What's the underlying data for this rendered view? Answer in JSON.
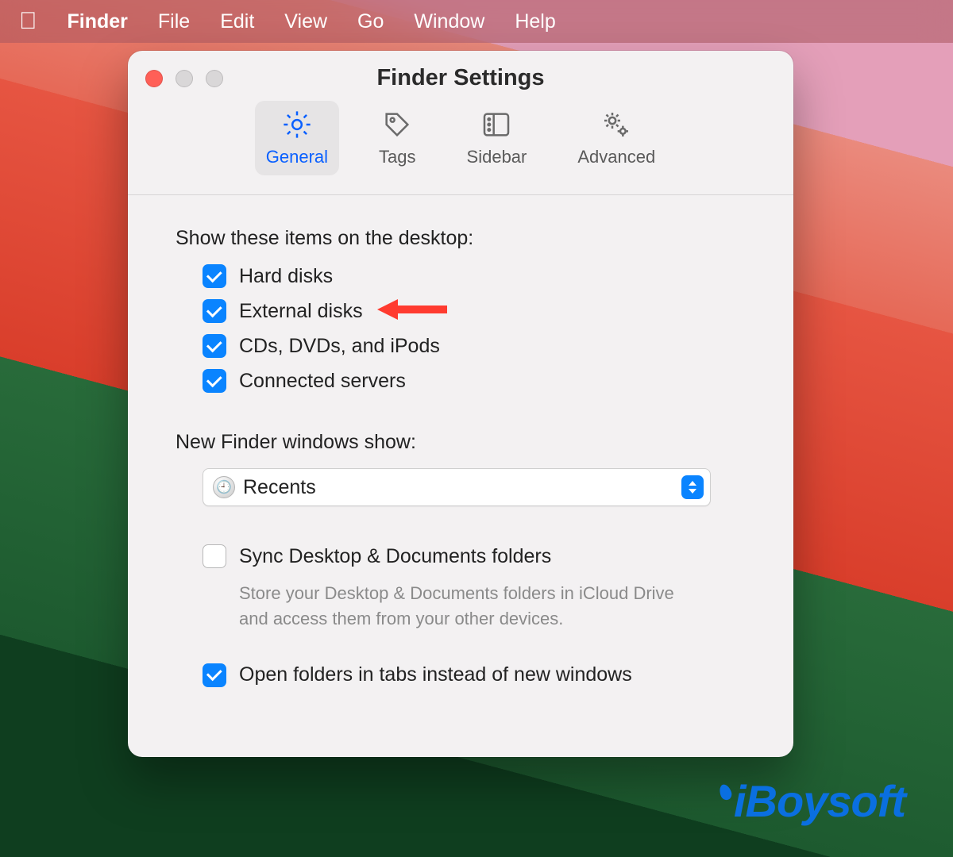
{
  "menubar": {
    "app": "Finder",
    "items": [
      "File",
      "Edit",
      "View",
      "Go",
      "Window",
      "Help"
    ]
  },
  "window": {
    "title": "Finder Settings",
    "tabs": [
      {
        "label": "General",
        "active": true
      },
      {
        "label": "Tags",
        "active": false
      },
      {
        "label": "Sidebar",
        "active": false
      },
      {
        "label": "Advanced",
        "active": false
      }
    ]
  },
  "general": {
    "show_label": "Show these items on the desktop:",
    "items": [
      {
        "label": "Hard disks",
        "checked": true
      },
      {
        "label": "External disks",
        "checked": true,
        "highlight": true
      },
      {
        "label": "CDs, DVDs, and iPods",
        "checked": true
      },
      {
        "label": "Connected servers",
        "checked": true
      }
    ],
    "new_window_label": "New Finder windows show:",
    "new_window_value": "Recents",
    "sync": {
      "label": "Sync Desktop & Documents folders",
      "checked": false
    },
    "sync_desc": "Store your Desktop & Documents folders in iCloud Drive and access them from your other devices.",
    "open_tabs": {
      "label": "Open folders in tabs instead of new windows",
      "checked": true
    }
  },
  "watermark": "iBoysoft",
  "colors": {
    "accent": "#0a84ff",
    "link": "#0a60ff",
    "arrow": "#ff3b30"
  }
}
